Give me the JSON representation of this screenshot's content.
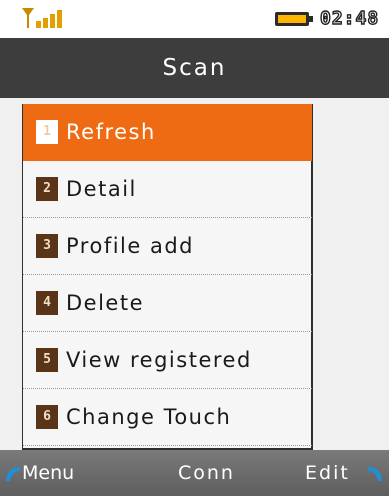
{
  "status": {
    "time": "02:48",
    "signal_icon": "signal-strength-icon",
    "battery_icon": "battery-icon",
    "accent_color": "#e8a000"
  },
  "title": "Scan",
  "menu": {
    "selected_index": 0,
    "items": [
      {
        "number": "1",
        "label": "Refresh"
      },
      {
        "number": "2",
        "label": "Detail"
      },
      {
        "number": "3",
        "label": "Profile add"
      },
      {
        "number": "4",
        "label": "Delete"
      },
      {
        "number": "5",
        "label": "View registered"
      },
      {
        "number": "6",
        "label": "Change Touch"
      }
    ],
    "highlight_color": "#ee6a13"
  },
  "softkeys": {
    "left": "Menu",
    "center": "Conn",
    "right": "Edit",
    "corner_icon_color": "#1e90d8"
  }
}
